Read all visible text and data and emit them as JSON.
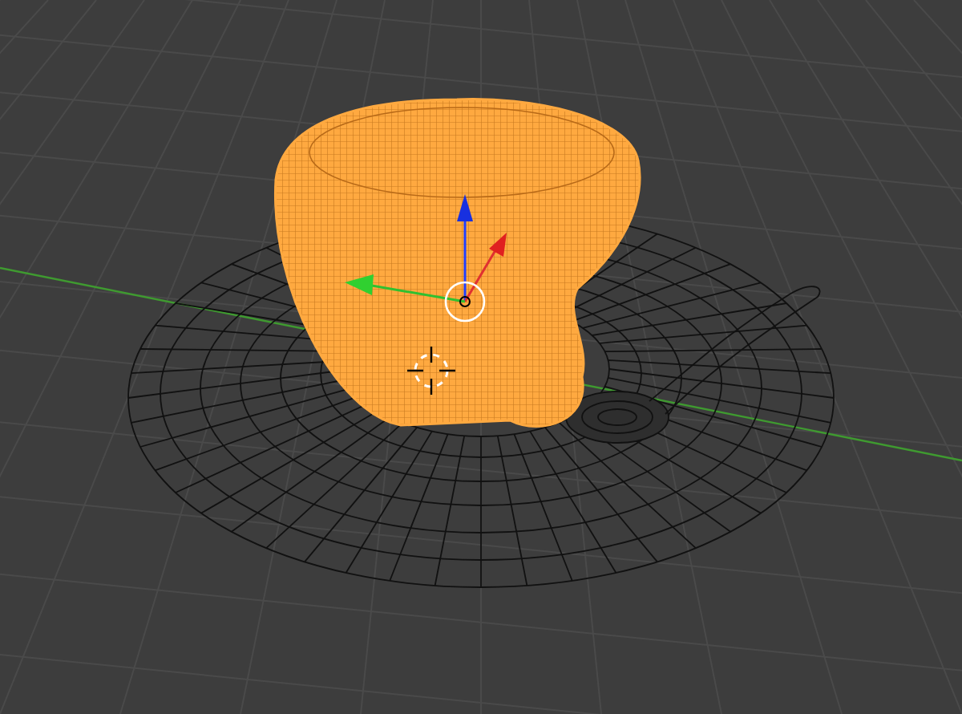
{
  "viewport": {
    "objects": [
      {
        "kind": "saucer",
        "selected": false
      },
      {
        "kind": "spoon",
        "selected": false
      },
      {
        "kind": "cup",
        "selected": true
      }
    ]
  }
}
